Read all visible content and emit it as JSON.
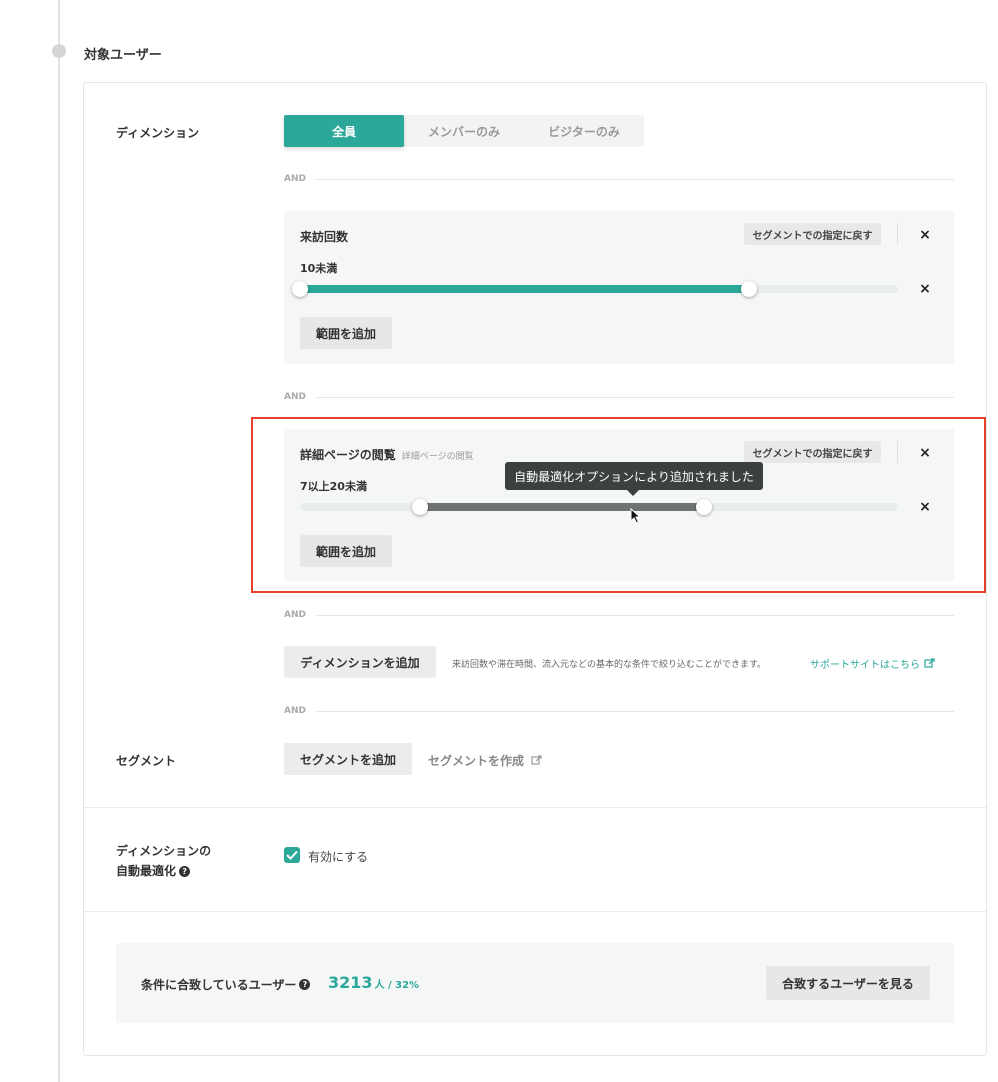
{
  "section": {
    "title": "対象ユーザー"
  },
  "dimension": {
    "label": "ディメンション",
    "segments": [
      "全員",
      "メンバーのみ",
      "ビジターのみ"
    ],
    "selected_index": 0,
    "and_label": "AND"
  },
  "panels": [
    {
      "title": "来訪回数",
      "subtitle": "",
      "revert_label": "セグメントでの指定に戻す",
      "range_label": "10未満",
      "range_start_fraction": 0.0,
      "range_end_fraction": 0.75,
      "fill_color": "#2ba89a",
      "add_range_label": "範囲を追加"
    },
    {
      "title": "詳細ページの閲覧",
      "subtitle": "詳細ページの閲覧",
      "revert_label": "セグメントでの指定に戻す",
      "range_label": "7以上20未満",
      "range_start_fraction": 0.2,
      "range_end_fraction": 0.675,
      "fill_color": "#6f7371",
      "add_range_label": "範囲を追加"
    }
  ],
  "tooltip": {
    "text": "自動最適化オプションにより追加されました"
  },
  "add_dimension": {
    "button_label": "ディメンションを追加",
    "help": "来訪回数や滞在時間、流入元などの基本的な条件で絞り込むことができます。",
    "link": "サポートサイトはこちら"
  },
  "segment": {
    "label": "セグメント",
    "add_label": "セグメントを追加",
    "create_label": "セグメントを作成"
  },
  "auto_opt": {
    "label_line1": "ディメンションの",
    "label_line2": "自動最適化",
    "checkbox_label": "有効にする",
    "checked": true
  },
  "result": {
    "label": "条件に合致しているユーザー",
    "count": "3213",
    "unit": "人 / 32%",
    "button_label": "合致するユーザーを見る"
  },
  "colors": {
    "accent": "#2ba89a",
    "highlight": "#e8412b"
  }
}
